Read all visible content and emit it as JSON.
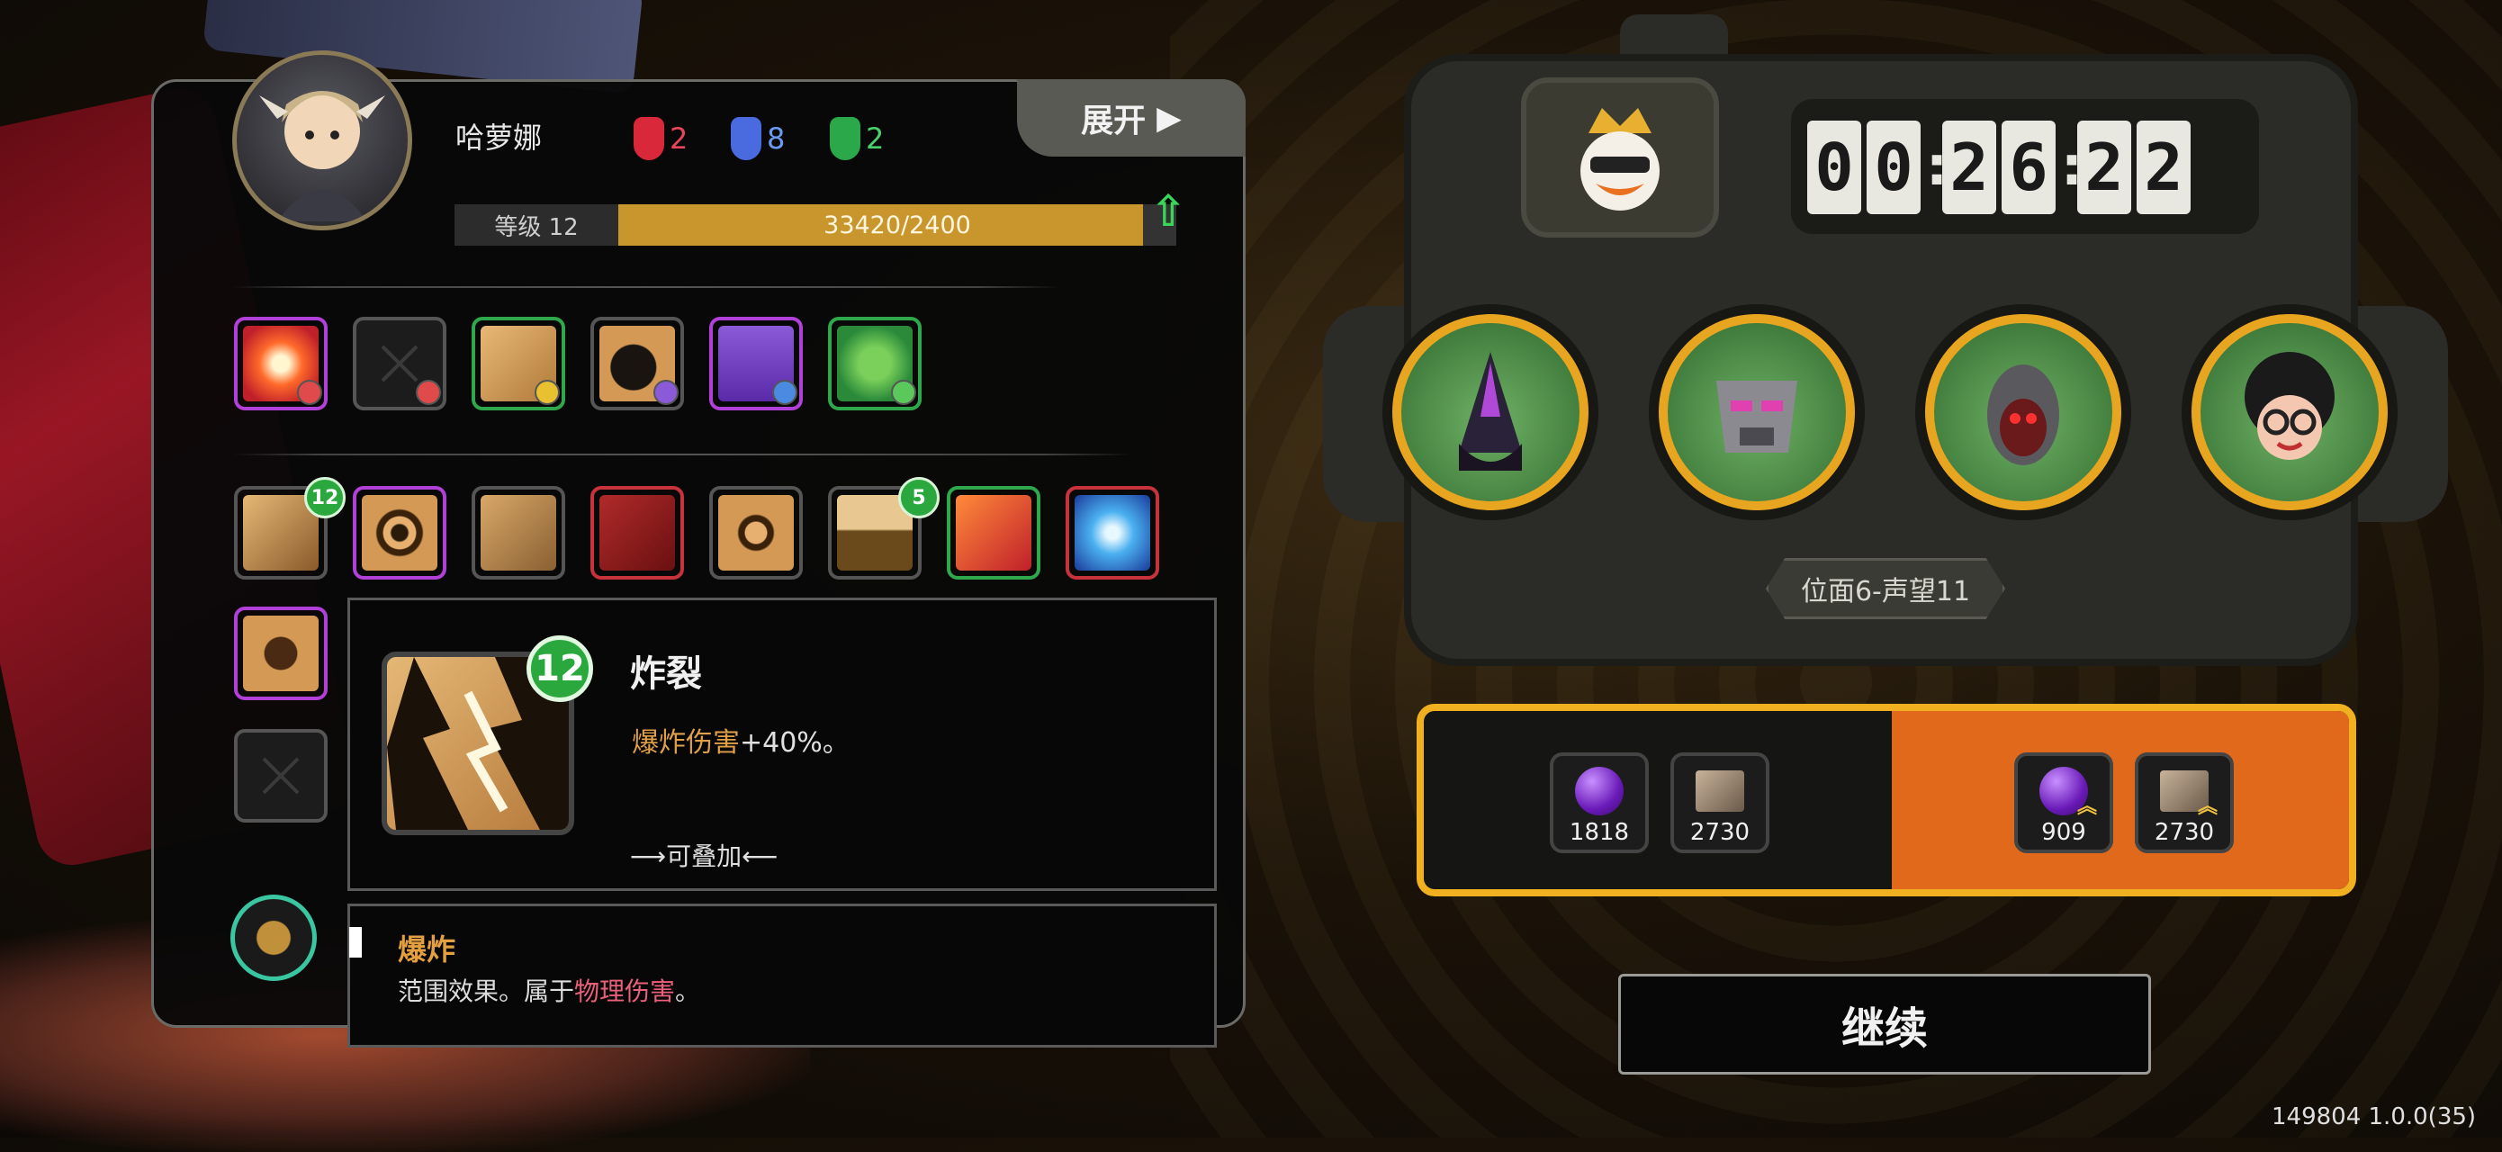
{
  "character": {
    "name": "哈萝娜",
    "gems": [
      {
        "color": "#d8283a",
        "count": "2",
        "count_color": "#e8445a"
      },
      {
        "color": "#4a6ae0",
        "count": "8",
        "count_color": "#6a9af0"
      },
      {
        "color": "#2aa84a",
        "count": "2",
        "count_color": "#4ad06a"
      }
    ],
    "level_label": "等级 12",
    "xp_text": "33420/2400",
    "xp_fill_fraction": 0.94
  },
  "expand_button": {
    "label": "展开",
    "icon": "triangle-right-icon"
  },
  "equipped_slots": [
    {
      "name": "explosion-burst",
      "border": "purple",
      "mini_icon": "lightning-icon"
    },
    {
      "name": "empty",
      "border": "grey",
      "mini_icon": "lightning-icon"
    },
    {
      "name": "drill-creature",
      "border": "green",
      "mini_icon": "sparkle-icon"
    },
    {
      "name": "bomb",
      "border": "grey",
      "mini_icon": "swirl-icon"
    },
    {
      "name": "robot-helmet",
      "border": "purple",
      "mini_icon": "diamond-icon"
    },
    {
      "name": "green-armor",
      "border": "green",
      "mini_icon": "shield-icon"
    }
  ],
  "skills_row1": [
    {
      "name": "crack-burst",
      "border": "grey",
      "badge": "12"
    },
    {
      "name": "vortex",
      "border": "purple",
      "badge": ""
    },
    {
      "name": "chain-links",
      "border": "grey",
      "badge": ""
    },
    {
      "name": "battle-axe",
      "border": "red",
      "badge": ""
    },
    {
      "name": "compass-gear",
      "border": "grey",
      "badge": ""
    },
    {
      "name": "sunrise",
      "border": "grey",
      "badge": "5"
    },
    {
      "name": "fire-spear",
      "border": "green",
      "badge": ""
    },
    {
      "name": "ice-shatter",
      "border": "red",
      "badge": ""
    }
  ],
  "tooltip": {
    "title": "炸裂",
    "level_badge": "12",
    "desc_highlight": "爆炸伤害",
    "desc_rest": "+40%。",
    "stack_note": "⟶可叠加⟵"
  },
  "subtooltip": {
    "title": "爆炸",
    "desc_prefix": "范围效果。属于",
    "desc_highlight": "物理伤害",
    "desc_suffix": "。"
  },
  "machine": {
    "boss_icon": "crowned-duck-icon",
    "timer": {
      "h1": "0",
      "h2": "0",
      "m1": "2",
      "m2": "6",
      "s1": "2",
      "s2": "2"
    },
    "heroes": [
      "hooded-assassin-icon",
      "cyber-mask-icon",
      "red-eyed-warrior-icon",
      "afro-glasses-kid-icon"
    ],
    "plate_label": "位面6-声望11"
  },
  "rewards": {
    "current": [
      {
        "icon": "purple-orb-icon",
        "value": "1818"
      },
      {
        "icon": "book-icon",
        "value": "2730"
      }
    ],
    "bonus": [
      {
        "icon": "purple-orb-icon",
        "value": "909"
      },
      {
        "icon": "book-icon",
        "value": "2730"
      }
    ],
    "accent": "#e0691c",
    "frame": "#f0b020"
  },
  "continue_button": {
    "label": "继续"
  },
  "version": "149804 1.0.0(35)"
}
